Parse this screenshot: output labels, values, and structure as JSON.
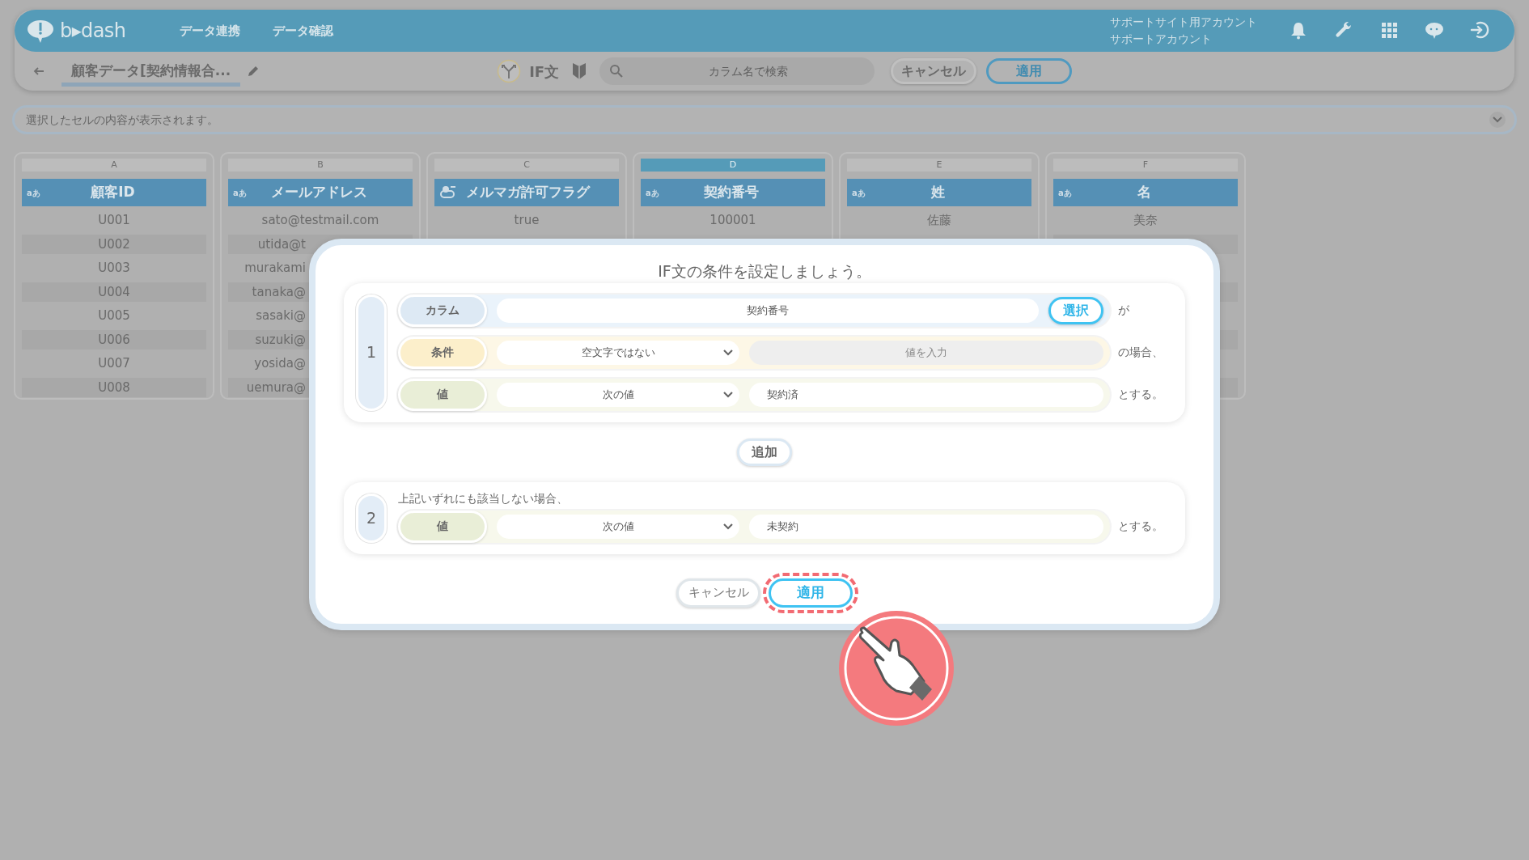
{
  "header": {
    "logo": "b▸dash",
    "nav": [
      "データ連携",
      "データ確認"
    ],
    "account": [
      "サポートサイト用アカウント",
      "サポートアカウント"
    ]
  },
  "toolbar": {
    "title": "顧客データ[契約情報合...",
    "mode": "IF文",
    "search": {
      "placeholder": "カラム名で検索"
    },
    "buttons": [
      {
        "label": "キャンセル",
        "kind": "cancel"
      },
      {
        "label": "適用",
        "kind": "apply"
      }
    ]
  },
  "cell_view": {
    "placeholder": "選択したセルの内容が表示されます。"
  },
  "columns": [
    {
      "letter": "A",
      "kind": "text",
      "type_label": "aあ",
      "name": "顧客ID",
      "selected": false,
      "cells": [
        "U001",
        "U002",
        "U003",
        "U004",
        "U005",
        "U006",
        "U007",
        "U008"
      ]
    },
    {
      "letter": "B",
      "kind": "text",
      "type_label": "aあ",
      "name": "メールアドレス",
      "selected": false,
      "cells": [
        "sato@testmail.com",
        "utida@t",
        "murakami",
        "tanaka@",
        "sasaki@",
        "suzuki@",
        "yosida@",
        "uemura@"
      ]
    },
    {
      "letter": "C",
      "kind": "flag",
      "name": "メルマガ許可フラグ",
      "selected": false,
      "cells": [
        "true"
      ]
    },
    {
      "letter": "D",
      "kind": "text",
      "type_label": "aあ",
      "name": "契約番号",
      "selected": true,
      "cells": [
        "100001"
      ]
    },
    {
      "letter": "E",
      "kind": "text",
      "type_label": "aあ",
      "name": "姓",
      "selected": false,
      "cells": [
        "佐藤"
      ]
    },
    {
      "letter": "F",
      "kind": "text",
      "type_label": "aあ",
      "name": "名",
      "selected": false,
      "cells": [
        "美奈"
      ]
    }
  ],
  "dialog": {
    "title": "IF文の条件を設定しましょう。",
    "rules": [
      {
        "number": "1",
        "rows": [
          {
            "kind": "column",
            "label": "カラム",
            "value": "契約番号",
            "button": "選択",
            "suffix": "が"
          },
          {
            "kind": "condition",
            "label": "条件",
            "select": "空文字ではない",
            "placeholder": "値を入力",
            "suffix": "の場合、"
          },
          {
            "kind": "value",
            "label": "値",
            "select": "次の値",
            "value": "契約済",
            "suffix": "とする。"
          }
        ]
      }
    ],
    "add_button": "追加",
    "default_rule": {
      "number": "2",
      "note": "上記いずれにも該当しない場合、",
      "rows": [
        {
          "kind": "value",
          "label": "値",
          "select": "次の値",
          "value": "未契約",
          "suffix": "とする。"
        }
      ]
    },
    "buttons": [
      {
        "label": "キャンセル",
        "kind": "cancel",
        "highlighted": false
      },
      {
        "label": "適用",
        "kind": "apply",
        "highlighted": true
      }
    ]
  }
}
